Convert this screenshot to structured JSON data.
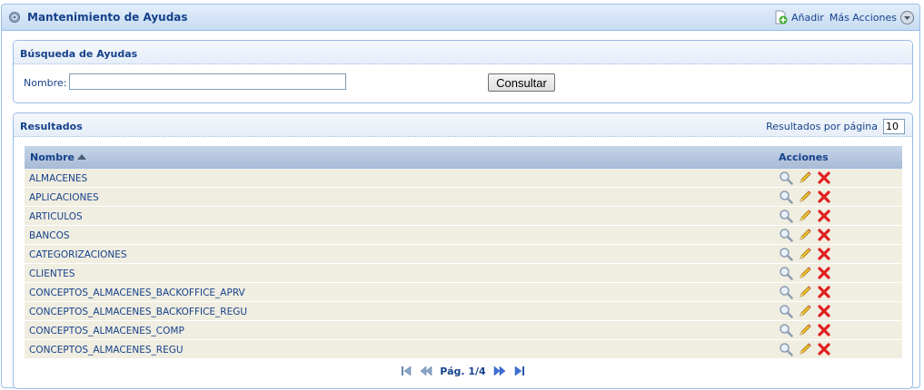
{
  "header": {
    "title": "Mantenimiento de Ayudas",
    "add_label": "Añadir",
    "more_label": "Más Acciones"
  },
  "search": {
    "title": "Búsqueda de Ayudas",
    "name_label": "Nombre:",
    "name_value": "",
    "button_label": "Consultar"
  },
  "results": {
    "title": "Resultados",
    "per_page_label": "Resultados por página",
    "per_page_value": "10",
    "columns": {
      "name": "Nombre",
      "actions": "Acciones"
    },
    "rows": [
      {
        "name": "ALMACENES"
      },
      {
        "name": "APLICACIONES"
      },
      {
        "name": "ARTICULOS"
      },
      {
        "name": "BANCOS"
      },
      {
        "name": "CATEGORIZACIONES"
      },
      {
        "name": "CLIENTES"
      },
      {
        "name": "CONCEPTOS_ALMACENES_BACKOFFICE_APRV"
      },
      {
        "name": "CONCEPTOS_ALMACENES_BACKOFFICE_REGU"
      },
      {
        "name": "CONCEPTOS_ALMACENES_COMP"
      },
      {
        "name": "CONCEPTOS_ALMACENES_REGU"
      }
    ],
    "row_actions": [
      "view-icon",
      "edit-icon",
      "delete-icon"
    ],
    "pager": {
      "text": "Pág. 1/4"
    }
  },
  "colors": {
    "accent": "#15428b",
    "border": "#99bbe8",
    "row_bg": "#f0ede1",
    "delete": "#e02020"
  }
}
